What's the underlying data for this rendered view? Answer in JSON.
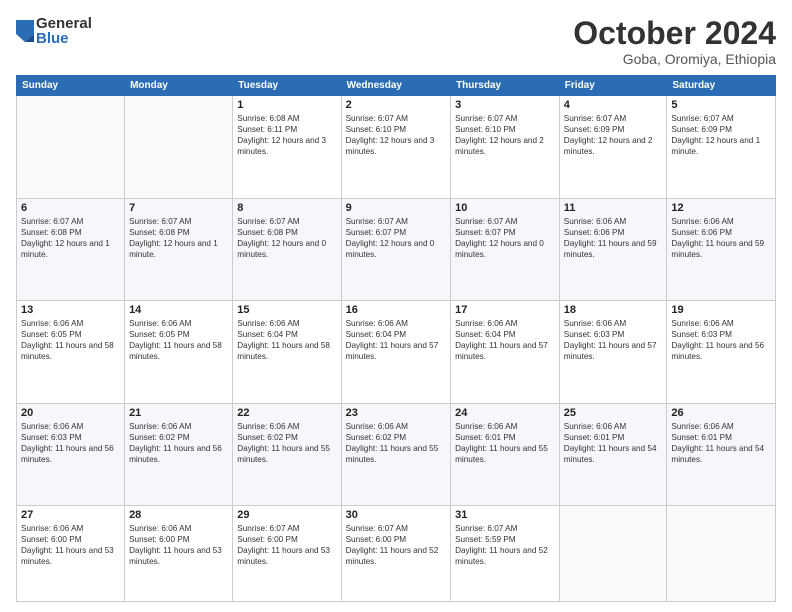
{
  "logo": {
    "general": "General",
    "blue": "Blue"
  },
  "calendar": {
    "title": "October 2024",
    "subtitle": "Goba, Oromiya, Ethiopia",
    "headers": [
      "Sunday",
      "Monday",
      "Tuesday",
      "Wednesday",
      "Thursday",
      "Friday",
      "Saturday"
    ],
    "weeks": [
      [
        {
          "day": "",
          "sunrise": "",
          "sunset": "",
          "daylight": ""
        },
        {
          "day": "",
          "sunrise": "",
          "sunset": "",
          "daylight": ""
        },
        {
          "day": "1",
          "sunrise": "Sunrise: 6:08 AM",
          "sunset": "Sunset: 6:11 PM",
          "daylight": "Daylight: 12 hours and 3 minutes."
        },
        {
          "day": "2",
          "sunrise": "Sunrise: 6:07 AM",
          "sunset": "Sunset: 6:10 PM",
          "daylight": "Daylight: 12 hours and 3 minutes."
        },
        {
          "day": "3",
          "sunrise": "Sunrise: 6:07 AM",
          "sunset": "Sunset: 6:10 PM",
          "daylight": "Daylight: 12 hours and 2 minutes."
        },
        {
          "day": "4",
          "sunrise": "Sunrise: 6:07 AM",
          "sunset": "Sunset: 6:09 PM",
          "daylight": "Daylight: 12 hours and 2 minutes."
        },
        {
          "day": "5",
          "sunrise": "Sunrise: 6:07 AM",
          "sunset": "Sunset: 6:09 PM",
          "daylight": "Daylight: 12 hours and 1 minute."
        }
      ],
      [
        {
          "day": "6",
          "sunrise": "Sunrise: 6:07 AM",
          "sunset": "Sunset: 6:08 PM",
          "daylight": "Daylight: 12 hours and 1 minute."
        },
        {
          "day": "7",
          "sunrise": "Sunrise: 6:07 AM",
          "sunset": "Sunset: 6:08 PM",
          "daylight": "Daylight: 12 hours and 1 minute."
        },
        {
          "day": "8",
          "sunrise": "Sunrise: 6:07 AM",
          "sunset": "Sunset: 6:08 PM",
          "daylight": "Daylight: 12 hours and 0 minutes."
        },
        {
          "day": "9",
          "sunrise": "Sunrise: 6:07 AM",
          "sunset": "Sunset: 6:07 PM",
          "daylight": "Daylight: 12 hours and 0 minutes."
        },
        {
          "day": "10",
          "sunrise": "Sunrise: 6:07 AM",
          "sunset": "Sunset: 6:07 PM",
          "daylight": "Daylight: 12 hours and 0 minutes."
        },
        {
          "day": "11",
          "sunrise": "Sunrise: 6:06 AM",
          "sunset": "Sunset: 6:06 PM",
          "daylight": "Daylight: 11 hours and 59 minutes."
        },
        {
          "day": "12",
          "sunrise": "Sunrise: 6:06 AM",
          "sunset": "Sunset: 6:06 PM",
          "daylight": "Daylight: 11 hours and 59 minutes."
        }
      ],
      [
        {
          "day": "13",
          "sunrise": "Sunrise: 6:06 AM",
          "sunset": "Sunset: 6:05 PM",
          "daylight": "Daylight: 11 hours and 58 minutes."
        },
        {
          "day": "14",
          "sunrise": "Sunrise: 6:06 AM",
          "sunset": "Sunset: 6:05 PM",
          "daylight": "Daylight: 11 hours and 58 minutes."
        },
        {
          "day": "15",
          "sunrise": "Sunrise: 6:06 AM",
          "sunset": "Sunset: 6:04 PM",
          "daylight": "Daylight: 11 hours and 58 minutes."
        },
        {
          "day": "16",
          "sunrise": "Sunrise: 6:06 AM",
          "sunset": "Sunset: 6:04 PM",
          "daylight": "Daylight: 11 hours and 57 minutes."
        },
        {
          "day": "17",
          "sunrise": "Sunrise: 6:06 AM",
          "sunset": "Sunset: 6:04 PM",
          "daylight": "Daylight: 11 hours and 57 minutes."
        },
        {
          "day": "18",
          "sunrise": "Sunrise: 6:06 AM",
          "sunset": "Sunset: 6:03 PM",
          "daylight": "Daylight: 11 hours and 57 minutes."
        },
        {
          "day": "19",
          "sunrise": "Sunrise: 6:06 AM",
          "sunset": "Sunset: 6:03 PM",
          "daylight": "Daylight: 11 hours and 56 minutes."
        }
      ],
      [
        {
          "day": "20",
          "sunrise": "Sunrise: 6:06 AM",
          "sunset": "Sunset: 6:03 PM",
          "daylight": "Daylight: 11 hours and 56 minutes."
        },
        {
          "day": "21",
          "sunrise": "Sunrise: 6:06 AM",
          "sunset": "Sunset: 6:02 PM",
          "daylight": "Daylight: 11 hours and 56 minutes."
        },
        {
          "day": "22",
          "sunrise": "Sunrise: 6:06 AM",
          "sunset": "Sunset: 6:02 PM",
          "daylight": "Daylight: 11 hours and 55 minutes."
        },
        {
          "day": "23",
          "sunrise": "Sunrise: 6:06 AM",
          "sunset": "Sunset: 6:02 PM",
          "daylight": "Daylight: 11 hours and 55 minutes."
        },
        {
          "day": "24",
          "sunrise": "Sunrise: 6:06 AM",
          "sunset": "Sunset: 6:01 PM",
          "daylight": "Daylight: 11 hours and 55 minutes."
        },
        {
          "day": "25",
          "sunrise": "Sunrise: 6:06 AM",
          "sunset": "Sunset: 6:01 PM",
          "daylight": "Daylight: 11 hours and 54 minutes."
        },
        {
          "day": "26",
          "sunrise": "Sunrise: 6:06 AM",
          "sunset": "Sunset: 6:01 PM",
          "daylight": "Daylight: 11 hours and 54 minutes."
        }
      ],
      [
        {
          "day": "27",
          "sunrise": "Sunrise: 6:06 AM",
          "sunset": "Sunset: 6:00 PM",
          "daylight": "Daylight: 11 hours and 53 minutes."
        },
        {
          "day": "28",
          "sunrise": "Sunrise: 6:06 AM",
          "sunset": "Sunset: 6:00 PM",
          "daylight": "Daylight: 11 hours and 53 minutes."
        },
        {
          "day": "29",
          "sunrise": "Sunrise: 6:07 AM",
          "sunset": "Sunset: 6:00 PM",
          "daylight": "Daylight: 11 hours and 53 minutes."
        },
        {
          "day": "30",
          "sunrise": "Sunrise: 6:07 AM",
          "sunset": "Sunset: 6:00 PM",
          "daylight": "Daylight: 11 hours and 52 minutes."
        },
        {
          "day": "31",
          "sunrise": "Sunrise: 6:07 AM",
          "sunset": "Sunset: 5:59 PM",
          "daylight": "Daylight: 11 hours and 52 minutes."
        },
        {
          "day": "",
          "sunrise": "",
          "sunset": "",
          "daylight": ""
        },
        {
          "day": "",
          "sunrise": "",
          "sunset": "",
          "daylight": ""
        }
      ]
    ]
  }
}
